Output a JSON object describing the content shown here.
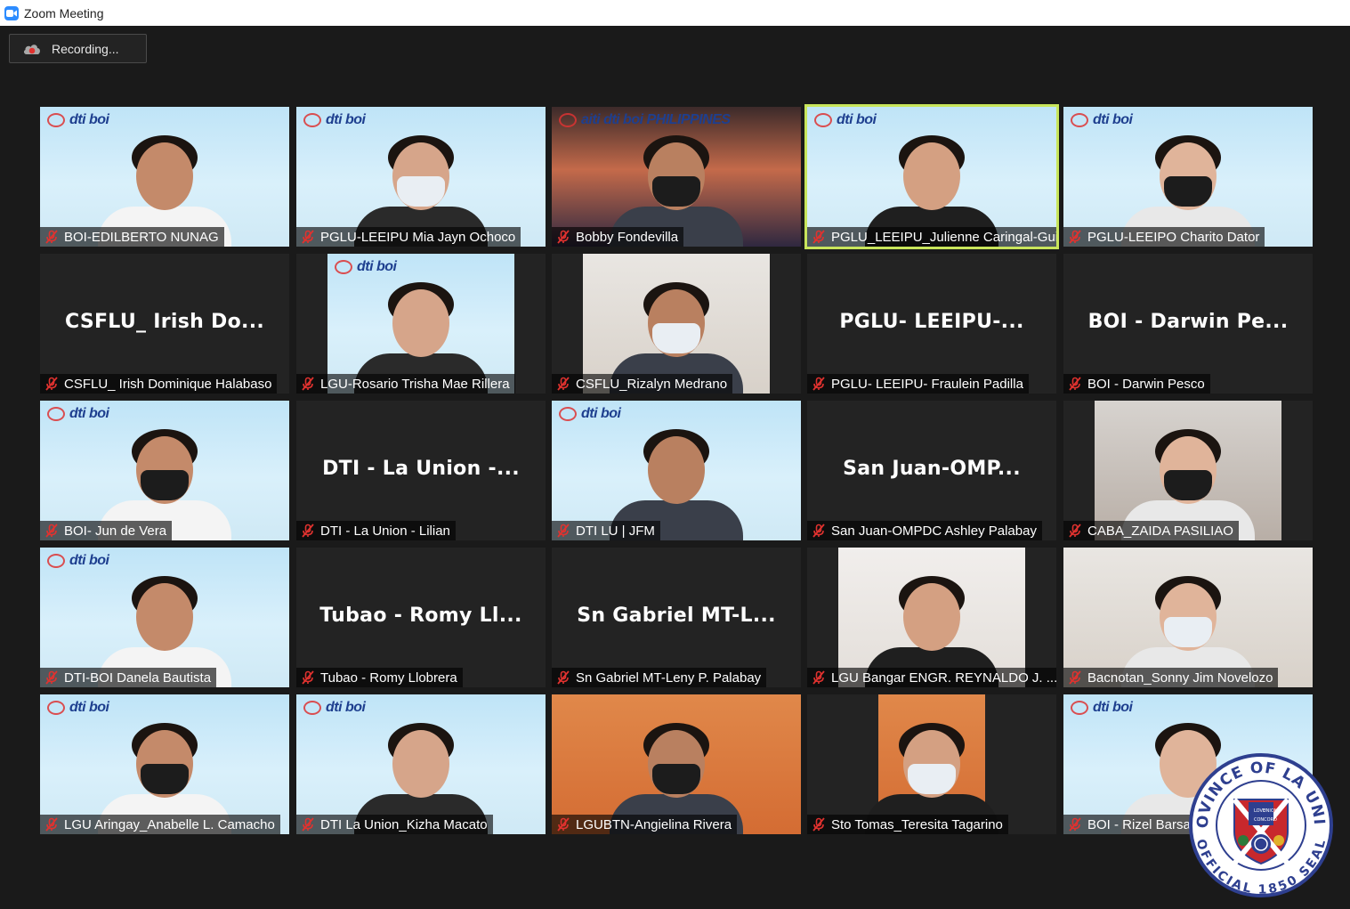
{
  "window": {
    "title": "Zoom Meeting"
  },
  "recording": {
    "label": "Recording..."
  },
  "colors": {
    "active_speaker": "#c8e55b",
    "mic_muted": "#e0322f",
    "zoom_blue": "#2d8cff"
  },
  "tiles": [
    {
      "label": "BOI-EDILBERTO NUNAG",
      "logo": "dti boi"
    },
    {
      "label": "PGLU-LEEIPU Mia Jayn Ochoco",
      "logo": "dti boi"
    },
    {
      "label": "Bobby Fondevilla",
      "logo": "aiti dti boi PHILIPPINES"
    },
    {
      "label": "PGLU_LEEIPU_Julienne Caringal-Guia...",
      "logo": "dti boi",
      "active": true
    },
    {
      "label": "PGLU-LEEIPO Charito Dator",
      "logo": "dti boi"
    },
    {
      "label": "CSFLU_ Irish Dominique Halabaso",
      "big": "CSFLU_ Irish Do..."
    },
    {
      "label": "LGU-Rosario Trisha Mae Rillera",
      "logo": "dti boi"
    },
    {
      "label": "CSFLU_Rizalyn Medrano"
    },
    {
      "label": "PGLU- LEEIPU- Fraulein Padilla",
      "big": "PGLU- LEEIPU-..."
    },
    {
      "label": "BOI - Darwin Pesco",
      "big": "BOI - Darwin Pe..."
    },
    {
      "label": "BOI- Jun de Vera",
      "logo": "dti boi"
    },
    {
      "label": "DTI - La Union - Lilian",
      "big": "DTI - La Union -..."
    },
    {
      "label": "DTI LU | JFM",
      "logo": "dti boi"
    },
    {
      "label": "San Juan-OMPDC Ashley Palabay",
      "big": "San Juan-OMP..."
    },
    {
      "label": "CABA_ZAIDA PASILIAO"
    },
    {
      "label": "DTI-BOI Danela Bautista",
      "logo": "dti boi"
    },
    {
      "label": "Tubao - Romy Llobrera",
      "big": "Tubao - Romy Ll..."
    },
    {
      "label": "Sn Gabriel MT-Leny P. Palabay",
      "big": "Sn Gabriel MT-L..."
    },
    {
      "label": "LGU Bangar ENGR. REYNALDO J. ..."
    },
    {
      "label": "Bacnotan_Sonny Jim Novelozo"
    },
    {
      "label": "LGU Aringay_Anabelle L. Camacho",
      "logo": "dti boi"
    },
    {
      "label": "DTI La Union_Kizha Macato",
      "logo": "dti boi"
    },
    {
      "label": "LGUBTN-Angielina Rivera"
    },
    {
      "label": "Sto Tomas_Teresita Tagarino"
    },
    {
      "label": "BOI - Rizel Barsana",
      "logo": "dti boi"
    }
  ],
  "seal": {
    "top_text": "PROVINCE OF LA UNION",
    "bottom_text": "OFFICIAL 1850 SEAL",
    "shield_words": [
      "LOVE",
      "UNION",
      "CONCORD"
    ]
  }
}
